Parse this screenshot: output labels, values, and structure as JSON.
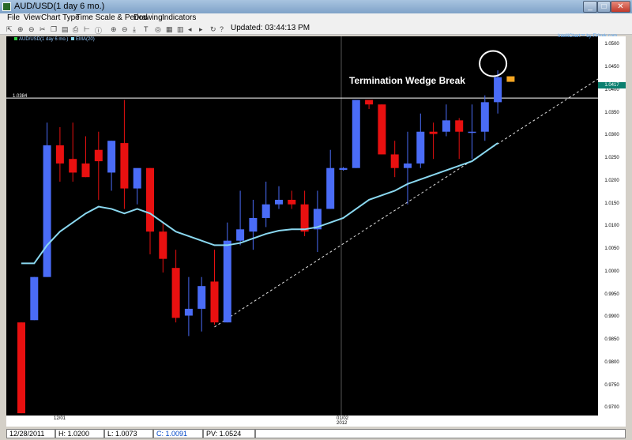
{
  "window": {
    "title": "AUD/USD(1 day  6 mo.)",
    "min": "_",
    "max": "□",
    "close": "✕"
  },
  "menu": [
    "File",
    "View",
    "Chart Type",
    "Time Scale & Period",
    "Drawing",
    "Indicators"
  ],
  "toolbar": {
    "updated": "Updated: 03:44:13 PM"
  },
  "chart": {
    "legend_symbol": "AUD/USD(1 day  6 mo.)",
    "legend_ema": "EMA(20)",
    "brand": "IntelliChart™ by FXtrek.com",
    "annotation": "Termination Wedge Break",
    "ref_line_label": "1.0384",
    "current_price": "1.0417",
    "y_ticks": [
      "1.0500",
      "1.0450",
      "1.0400",
      "1.0350",
      "1.0300",
      "1.0250",
      "1.0200",
      "1.0150",
      "1.0100",
      "1.0050",
      "1.0000",
      "0.9950",
      "0.9900",
      "0.9850",
      "0.9800",
      "0.9750",
      "0.9700"
    ],
    "x_ticks": [
      {
        "label": "12/01"
      },
      {
        "label": "01/02"
      },
      {
        "label": "2012"
      }
    ],
    "colors": {
      "up": "#4a6cf7",
      "down": "#e81010",
      "ema": "#8ad8f0",
      "trend": "#e0e0e0",
      "next": "#f5a623"
    }
  },
  "chart_data": {
    "type": "candlestick",
    "y_range": [
      0.9685,
      1.052
    ],
    "reference_line": 1.0384,
    "candles": [
      {
        "o": 0.989,
        "h": 0.989,
        "l": 0.969,
        "c": 0.969
      },
      {
        "o": 0.9895,
        "h": 0.999,
        "l": 0.9895,
        "c": 0.999
      },
      {
        "o": 0.999,
        "h": 1.033,
        "l": 0.999,
        "c": 1.028
      },
      {
        "o": 1.028,
        "h": 1.032,
        "l": 1.02,
        "c": 1.024
      },
      {
        "o": 1.025,
        "h": 1.033,
        "l": 1.02,
        "c": 1.022
      },
      {
        "o": 1.024,
        "h": 1.03,
        "l": 1.021,
        "c": 1.021
      },
      {
        "o": 1.027,
        "h": 1.031,
        "l": 1.016,
        "c": 1.0245
      },
      {
        "o": 1.022,
        "h": 1.029,
        "l": 1.018,
        "c": 1.029
      },
      {
        "o": 1.0285,
        "h": 1.038,
        "l": 1.014,
        "c": 1.0185
      },
      {
        "o": 1.0185,
        "h": 1.022,
        "l": 1.015,
        "c": 1.023
      },
      {
        "o": 1.023,
        "h": 1.023,
        "l": 1.004,
        "c": 1.009
      },
      {
        "o": 1.009,
        "h": 1.011,
        "l": 1.0,
        "c": 1.003
      },
      {
        "o": 1.001,
        "h": 1.005,
        "l": 0.989,
        "c": 0.99
      },
      {
        "o": 0.9905,
        "h": 0.999,
        "l": 0.986,
        "c": 0.992
      },
      {
        "o": 0.992,
        "h": 0.999,
        "l": 0.987,
        "c": 0.997
      },
      {
        "o": 0.998,
        "h": 1.005,
        "l": 0.9885,
        "c": 0.989
      },
      {
        "o": 0.989,
        "h": 1.011,
        "l": 0.989,
        "c": 1.007
      },
      {
        "o": 1.007,
        "h": 1.018,
        "l": 1.006,
        "c": 1.0095
      },
      {
        "o": 1.009,
        "h": 1.016,
        "l": 1.005,
        "c": 1.012
      },
      {
        "o": 1.012,
        "h": 1.02,
        "l": 1.01,
        "c": 1.015
      },
      {
        "o": 1.015,
        "h": 1.019,
        "l": 1.014,
        "c": 1.016
      },
      {
        "o": 1.016,
        "h": 1.018,
        "l": 1.014,
        "c": 1.015
      },
      {
        "o": 1.015,
        "h": 1.018,
        "l": 1.008,
        "c": 1.009
      },
      {
        "o": 1.0095,
        "h": 1.018,
        "l": 1.0045,
        "c": 1.014
      },
      {
        "o": 1.014,
        "h": 1.027,
        "l": 1.014,
        "c": 1.023
      },
      {
        "o": 1.0226,
        "h": 1.0232,
        "l": 1.0224,
        "c": 1.023
      },
      {
        "o": 1.023,
        "h": 1.038,
        "l": 1.023,
        "c": 1.038
      },
      {
        "o": 1.038,
        "h": 1.038,
        "l": 1.036,
        "c": 1.037
      },
      {
        "o": 1.037,
        "h": 1.037,
        "l": 1.026,
        "c": 1.026
      },
      {
        "o": 1.026,
        "h": 1.029,
        "l": 1.021,
        "c": 1.023
      },
      {
        "o": 1.023,
        "h": 1.031,
        "l": 1.015,
        "c": 1.024
      },
      {
        "o": 1.024,
        "h": 1.035,
        "l": 1.023,
        "c": 1.031
      },
      {
        "o": 1.031,
        "h": 1.033,
        "l": 1.025,
        "c": 1.0305
      },
      {
        "o": 1.031,
        "h": 1.037,
        "l": 1.03,
        "c": 1.0335
      },
      {
        "o": 1.0335,
        "h": 1.034,
        "l": 1.025,
        "c": 1.031
      },
      {
        "o": 1.031,
        "h": 1.037,
        "l": 1.025,
        "c": 1.031
      },
      {
        "o": 1.031,
        "h": 1.039,
        "l": 1.029,
        "c": 1.0375
      },
      {
        "o": 1.0375,
        "h": 1.0445,
        "l": 1.035,
        "c": 1.043
      }
    ],
    "ema": [
      1.002,
      1.002,
      1.006,
      1.009,
      1.011,
      1.013,
      1.0145,
      1.014,
      1.013,
      1.014,
      1.013,
      1.011,
      1.009,
      1.008,
      1.007,
      1.006,
      1.006,
      1.0065,
      1.0075,
      1.0085,
      1.0092,
      1.0095,
      1.0095,
      1.01,
      1.011,
      1.012,
      1.014,
      1.016,
      1.017,
      1.018,
      1.0195,
      1.0205,
      1.0215,
      1.0225,
      1.0235,
      1.0245,
      1.0265,
      1.0285
    ],
    "trendline": [
      {
        "i": 15,
        "y": 0.988
      },
      {
        "i": 45,
        "y": 1.043
      }
    ],
    "next_bar": {
      "o": 1.0432,
      "c": 1.042
    }
  },
  "status": {
    "date": "12/28/2011",
    "high": "H: 1.0200",
    "low": "L: 1.0073",
    "close": "C: 1.0091",
    "pv": "PV: 1.0524"
  }
}
